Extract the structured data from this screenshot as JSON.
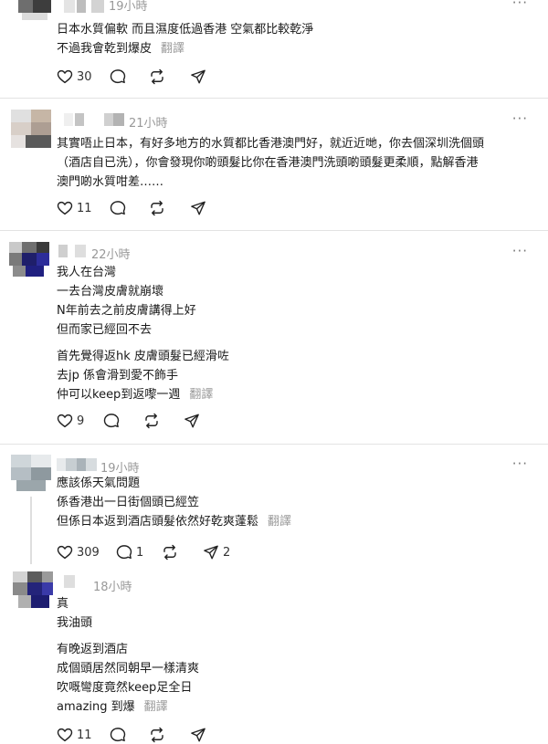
{
  "posts": [
    {
      "time": "19小時",
      "lines": [
        "日本水質偏軟 而且濕度低過香港 空氣都比較乾淨",
        "不過我會乾到爆皮"
      ],
      "translate": "翻譯",
      "likes": "30",
      "replies": "",
      "reposts": ""
    },
    {
      "time": "21小時",
      "lines": [
        "其實唔止日本，有好多地方的水質都比香港澳門好，就近近哋，你去個深圳洗個頭",
        "（酒店自已洗），你會發現你啲頭髮比你在香港澳門洗頭啲頭髮更柔順，點解香港",
        "澳門啲水質咁差……"
      ],
      "likes": "11",
      "replies": "",
      "reposts": ""
    },
    {
      "time": "22小時",
      "lines": [
        "我人在台灣",
        "一去台灣皮膚就崩壞",
        "N年前去之前皮膚講得上好",
        "但而家已經回不去"
      ],
      "lines2": [
        "首先覺得返hk 皮膚頭髮已經滑咗",
        "去jp 係會滑到愛不飾手",
        "仲可以keep到返嚟一週"
      ],
      "translate": "翻譯",
      "likes": "9",
      "replies": "",
      "reposts": ""
    },
    {
      "time": "19小時",
      "lines": [
        "應該係天氣問題￼",
        "係香港出一日街個頭已經笠",
        "但係日本返到酒店￼頭髮依然好乾爽￼蓬鬆"
      ],
      "translate": "翻譯",
      "likes": "309",
      "replies": "1",
      "reposts": "",
      "shares": "2"
    },
    {
      "time": "18小時",
      "lines": [
        "真",
        "我油頭"
      ],
      "lines2": [
        "有晚返到酒店",
        "成個頭居然同朝早一樣清爽",
        "吹嘅彎度竟然keep足全日",
        "amazing 到爆"
      ],
      "translate": "翻譯",
      "likes": "11",
      "replies": "",
      "reposts": ""
    }
  ],
  "more_label": "···",
  "icons": [
    "heart-icon",
    "comment-icon",
    "repost-icon",
    "share-icon"
  ]
}
